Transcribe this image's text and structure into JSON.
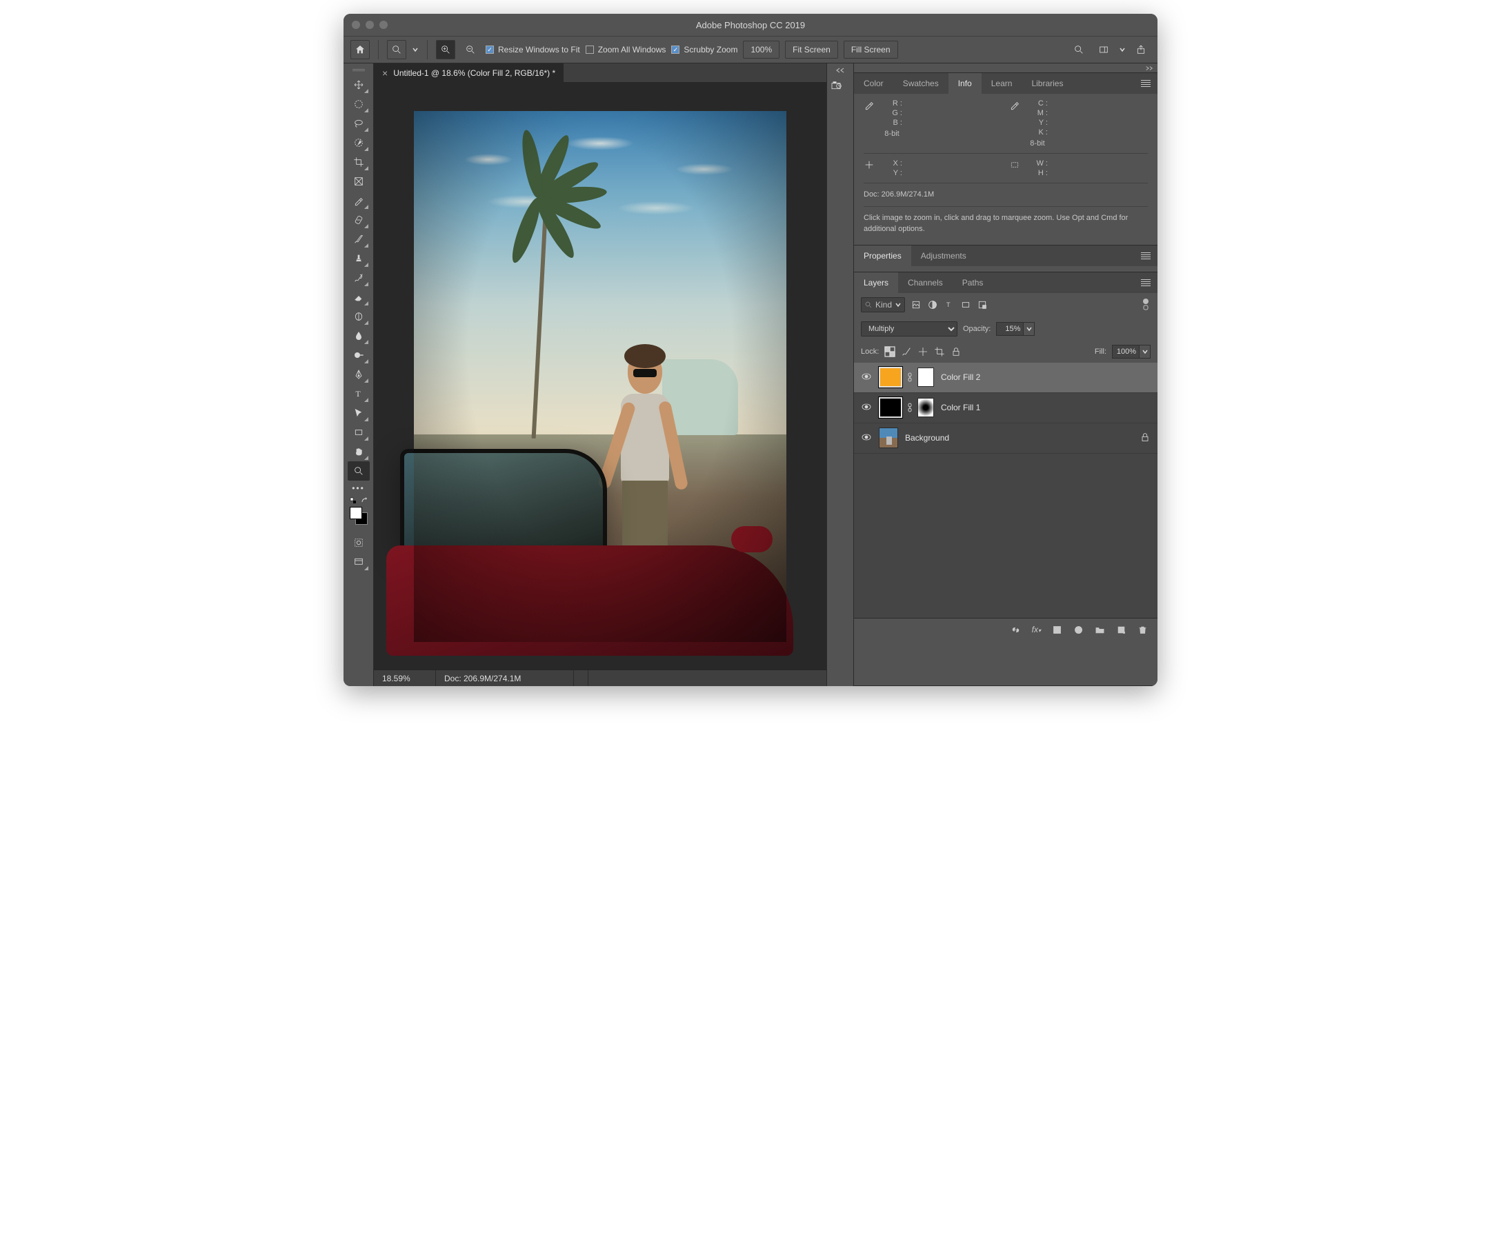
{
  "app": {
    "title": "Adobe Photoshop CC 2019"
  },
  "optionsbar": {
    "resize_windows": "Resize Windows to Fit",
    "zoom_all": "Zoom All Windows",
    "scrubby": "Scrubby Zoom",
    "zoom_pct": "100%",
    "fit_screen": "Fit Screen",
    "fill_screen": "Fill Screen"
  },
  "document": {
    "tab_title": "Untitled-1 @ 18.6% (Color Fill 2, RGB/16*) *",
    "status_zoom": "18.59%",
    "status_doc": "Doc: 206.9M/274.1M"
  },
  "right_tabs_top": {
    "color": "Color",
    "swatches": "Swatches",
    "info": "Info",
    "learn": "Learn",
    "libraries": "Libraries"
  },
  "info": {
    "rgb": [
      "R",
      "G",
      "B"
    ],
    "cmyk": [
      "C",
      "M",
      "Y",
      "K"
    ],
    "bit": "8-bit",
    "xy": [
      "X",
      "Y"
    ],
    "wh": [
      "W",
      "H"
    ],
    "docsize": "Doc: 206.9M/274.1M",
    "hint": "Click image to zoom in, click and drag to marquee zoom.  Use Opt and Cmd for additional options."
  },
  "right_tabs_mid": {
    "properties": "Properties",
    "adjustments": "Adjustments"
  },
  "right_tabs_bot": {
    "layers": "Layers",
    "channels": "Channels",
    "paths": "Paths"
  },
  "layers": {
    "kind": "Kind",
    "blend": "Multiply",
    "opacity_label": "Opacity:",
    "opacity": "15%",
    "lock_label": "Lock:",
    "fill_label": "Fill:",
    "fill": "100%",
    "items": [
      {
        "name": "Color Fill 2"
      },
      {
        "name": "Color Fill 1"
      },
      {
        "name": "Background"
      }
    ]
  }
}
